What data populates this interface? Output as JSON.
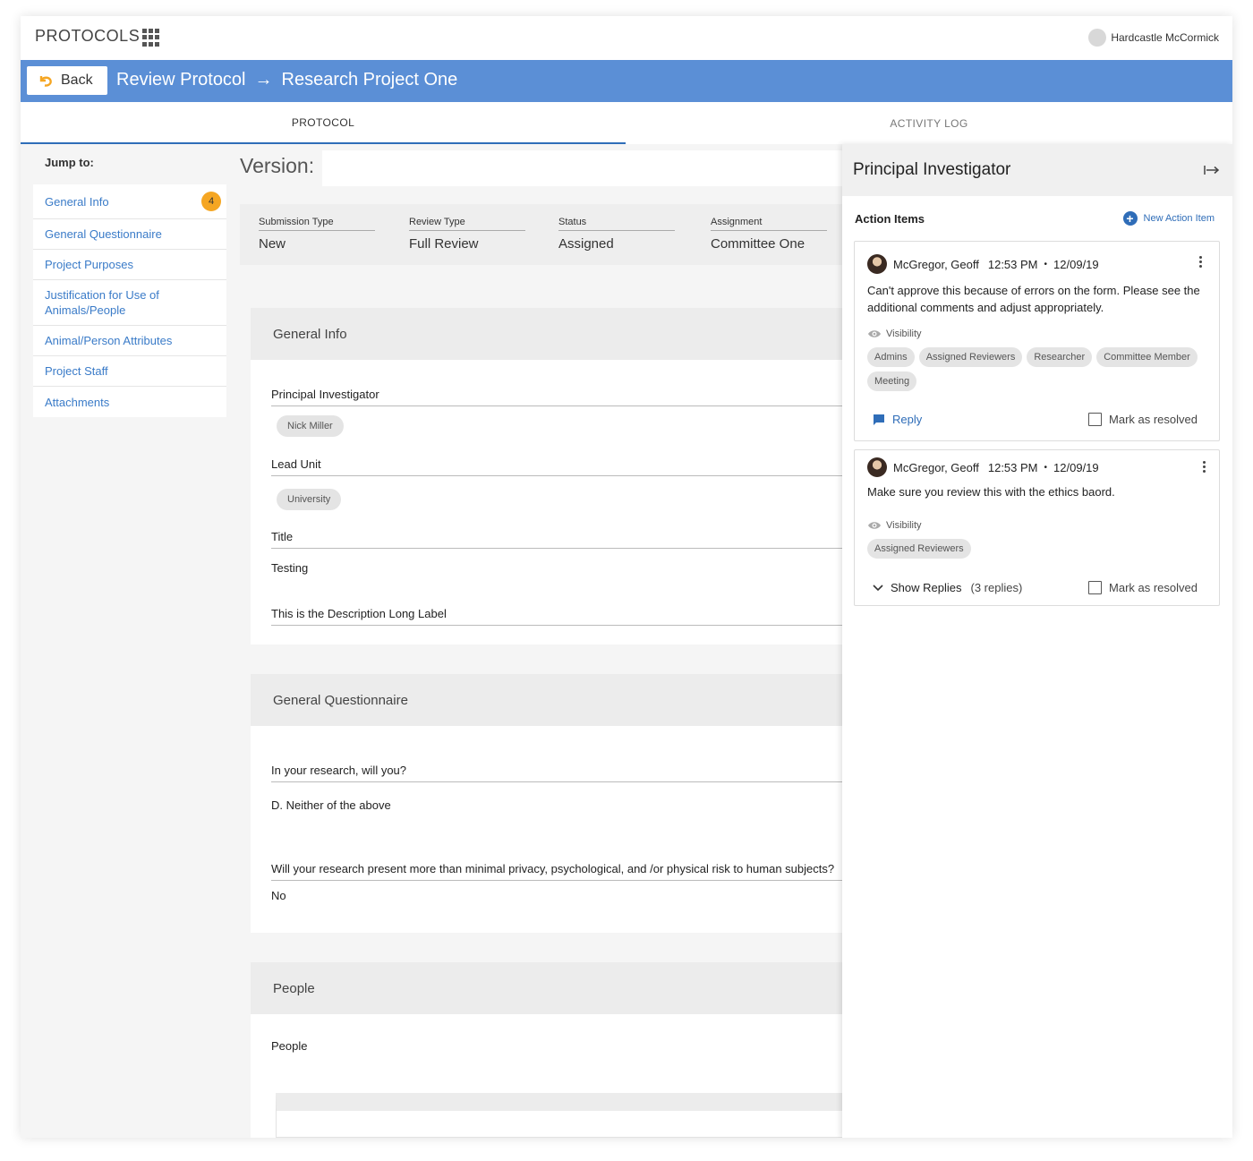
{
  "app": {
    "title": "PROTOCOLS",
    "user_name": "Hardcastle McCormick"
  },
  "header": {
    "back_label": "Back",
    "crumb_1": "Review Protocol",
    "arrow": "→",
    "crumb_2": "Research Project One"
  },
  "tabs": [
    {
      "label": "PROTOCOL",
      "active": true
    },
    {
      "label": "ACTIVITY LOG",
      "active": false
    }
  ],
  "sidebar": {
    "jump_label": "Jump to:",
    "items": [
      {
        "label": "General Info",
        "badge": "4"
      },
      {
        "label": "General Questionnaire"
      },
      {
        "label": "Project Purposes"
      },
      {
        "label": "Justification for Use of Animals/People"
      },
      {
        "label": "Animal/Person Attributes"
      },
      {
        "label": "Project Staff"
      },
      {
        "label": "Attachments"
      }
    ]
  },
  "main": {
    "version_label": "Version:",
    "meta": [
      {
        "label": "Submission Type",
        "value": "New"
      },
      {
        "label": "Review Type",
        "value": "Full Review"
      },
      {
        "label": "Status",
        "value": "Assigned"
      },
      {
        "label": "Assignment",
        "value": "Committee One"
      }
    ],
    "general_info": {
      "title": "General Info",
      "pi_label": "Principal Investigator",
      "pi_value": "Nick Miller",
      "lead_unit_label": "Lead Unit",
      "lead_unit_value": "University",
      "title_label": "Title",
      "title_value": "Testing",
      "description_label": "This is the Description Long Label"
    },
    "questionnaire": {
      "title": "General Questionnaire",
      "q1": "In your research, will you?",
      "a1": "D. Neither of the above",
      "q2": "Will your research present more than minimal privacy, psychological, and /or physical risk to human subjects?",
      "a2": "No"
    },
    "people": {
      "title": "People",
      "label": "People"
    }
  },
  "panel": {
    "title": "Principal Investigator",
    "action_items_label": "Action Items",
    "new_action_label": "New Action Item",
    "visibility_label": "Visibility",
    "reply_label": "Reply",
    "resolve_label": "Mark as resolved",
    "cards": [
      {
        "author": "McGregor, Geoff",
        "time": "12:53 PM",
        "date": "12/09/19",
        "message": "Can't approve this because of errors on the form. Please see the additional comments and adjust appropriately.",
        "chips": [
          "Admins",
          "Assigned Reviewers",
          "Researcher",
          "Committee Member",
          "Meeting"
        ]
      },
      {
        "author": "McGregor, Geoff",
        "time": "12:53 PM",
        "date": "12/09/19",
        "message": "Make sure you review this with the ethics baord.",
        "chips": [
          "Assigned Reviewers"
        ],
        "show_replies": "Show Replies",
        "replies_count": "(3 replies)"
      }
    ]
  },
  "colors": {
    "accent": "#5b8fd6",
    "link": "#3a7bc8",
    "badge": "#f5a623"
  }
}
